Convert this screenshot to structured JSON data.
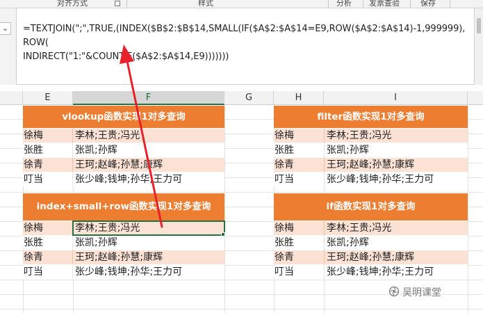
{
  "ribbon": {
    "groups": [
      "对齐方式",
      "样式",
      "分析",
      "发票查验",
      "保存"
    ]
  },
  "formula_bar": {
    "expand_glyph": "⌄",
    "formula": "=TEXTJOIN(\";\",TRUE,(INDEX($B$2:$B$14,SMALL(IF($A$2:$A$14=E9,ROW($A$2:$A$14)-1,999999),ROW(\nINDIRECT(\"1:\"&COUNTIF($A$2:$A$14,E9)))))))"
  },
  "columns": [
    {
      "label": "E",
      "selected": false
    },
    {
      "label": "F",
      "selected": true
    },
    {
      "label": "G",
      "selected": false
    },
    {
      "label": "H",
      "selected": false
    },
    {
      "label": "I",
      "selected": false
    }
  ],
  "tables": [
    {
      "title": "vlookup函数实现1对多查询",
      "rows": [
        {
          "name": "徐梅",
          "result": "李林;王贵;冯光"
        },
        {
          "name": "张胜",
          "result": "张凯;孙辉"
        },
        {
          "name": "徐青",
          "result": "王珂;赵峰;孙慧;康辉"
        },
        {
          "name": "叮当",
          "result": "张少峰;钱坤;孙华;王力可"
        }
      ]
    },
    {
      "title": "filter函数实现1对多查询",
      "rows": [
        {
          "name": "徐梅",
          "result": "李林;王贵;冯光"
        },
        {
          "name": "张胜",
          "result": "张凯;孙辉"
        },
        {
          "name": "徐青",
          "result": "王珂;赵峰;孙慧;康辉"
        },
        {
          "name": "叮当",
          "result": "张少峰;钱坤;孙华;王力可"
        }
      ]
    },
    {
      "title": "index+small+row函数实现1对多查询",
      "rows": [
        {
          "name": "徐梅",
          "result": "李林;王贵;冯光"
        },
        {
          "name": "张胜",
          "result": "张凯;孙辉"
        },
        {
          "name": "徐青",
          "result": "王珂;赵峰;孙慧;康辉"
        },
        {
          "name": "叮当",
          "result": "张少峰;钱坤;孙华;王力可"
        }
      ]
    },
    {
      "title": "if函数实现1对多查询",
      "rows": [
        {
          "name": "徐梅",
          "result": "李林;王贵;冯光"
        },
        {
          "name": "张胜",
          "result": "张凯;孙辉"
        },
        {
          "name": "徐青",
          "result": "王珂;赵峰;孙慧;康辉"
        },
        {
          "name": "叮当",
          "result": "张少峰;钱坤;孙华;王力可"
        }
      ]
    }
  ],
  "watermark": {
    "text": "吴明课堂",
    "icon": "wechat-channel-icon"
  },
  "colors": {
    "title_bg": "#ed7d31",
    "band_odd": "#fbe2d5",
    "selection": "#217346",
    "arrow": "#e8202a"
  }
}
